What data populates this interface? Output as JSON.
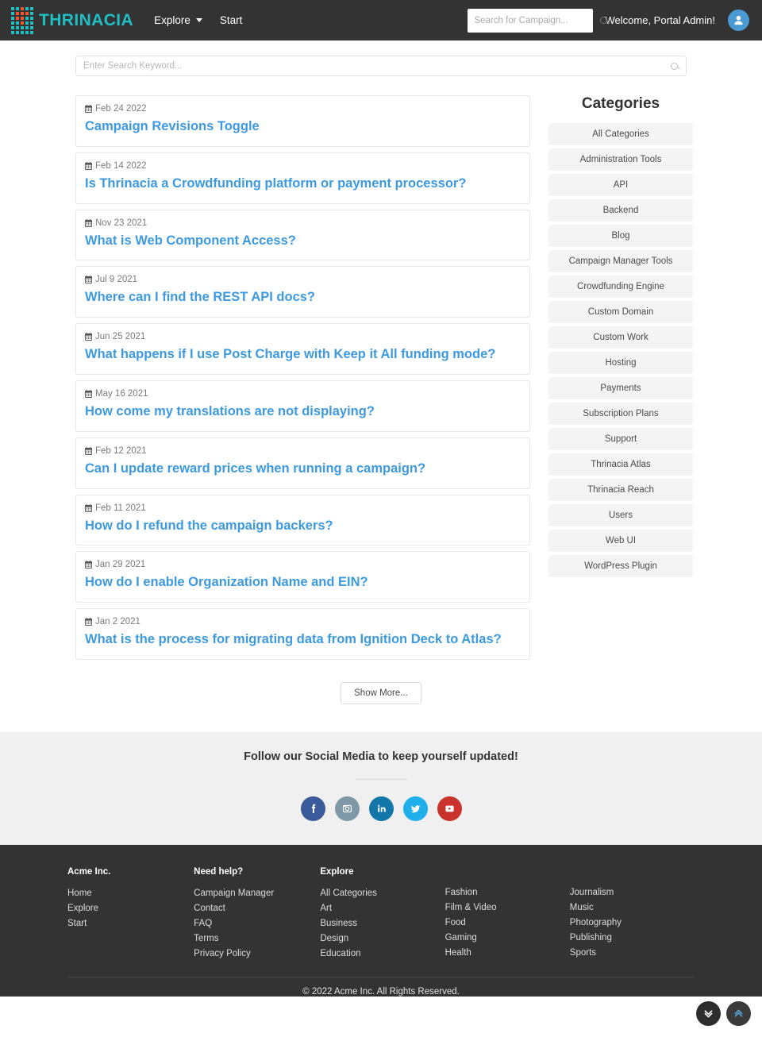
{
  "navbar": {
    "brand": "THRINACIA",
    "links": [
      {
        "label": "Explore",
        "has_caret": true,
        "icon": "chevron-down-icon"
      },
      {
        "label": "Start",
        "has_caret": false
      }
    ],
    "search": {
      "value": "",
      "placeholder": "Search for Campaign...",
      "icon": "search-icon"
    },
    "welcome": "Welcome, Portal Admin!",
    "avatar_icon": "user-avatar-icon",
    "bg_color": "#333333",
    "brand_color": "#1fbfc4",
    "brand_accent_color": "#f4572c"
  },
  "page_search": {
    "value": "",
    "placeholder": "Enter Search Keyword...",
    "icon": "search-icon"
  },
  "articles": {
    "items": [
      {
        "date": "Feb 24 2022",
        "title": "Campaign Revisions Toggle"
      },
      {
        "date": "Feb 14 2022",
        "title": "Is Thrinacia a Crowdfunding platform or payment processor?"
      },
      {
        "date": "Nov 23 2021",
        "title": "What is Web Component Access?"
      },
      {
        "date": "Jul 9 2021",
        "title": "Where can I find the REST API docs?"
      },
      {
        "date": "Jun 25 2021",
        "title": "What happens if I use Post Charge with Keep it All funding mode?"
      },
      {
        "date": "May 16 2021",
        "title": "How come my translations are not displaying?"
      },
      {
        "date": "Feb 12 2021",
        "title": "Can I update reward prices when running a campaign?"
      },
      {
        "date": "Feb 11 2021",
        "title": "How do I refund the campaign backers?"
      },
      {
        "date": "Jan 29 2021",
        "title": "How do I enable Organization Name and EIN?"
      },
      {
        "date": "Jan 2 2021",
        "title": "What is the process for migrating data from Ignition Deck to Atlas?"
      }
    ],
    "date_icon": "calendar-icon",
    "show_more_label": "Show More...",
    "title_color": "#3d9ae0"
  },
  "sidebar": {
    "title": "Categories",
    "items": [
      {
        "label": "All Categories"
      },
      {
        "label": "Administration Tools"
      },
      {
        "label": "API"
      },
      {
        "label": "Backend"
      },
      {
        "label": "Blog"
      },
      {
        "label": "Campaign Manager Tools"
      },
      {
        "label": "Crowdfunding Engine"
      },
      {
        "label": "Custom Domain"
      },
      {
        "label": "Custom Work"
      },
      {
        "label": "Hosting"
      },
      {
        "label": "Payments"
      },
      {
        "label": "Subscription Plans"
      },
      {
        "label": "Support"
      },
      {
        "label": "Thrinacia Atlas"
      },
      {
        "label": "Thrinacia Reach"
      },
      {
        "label": "Users"
      },
      {
        "label": "Web UI"
      },
      {
        "label": "WordPress Plugin"
      }
    ]
  },
  "social": {
    "title": "Follow our Social Media to keep yourself updated!",
    "icons": [
      {
        "name": "facebook-icon",
        "color": "#3b5a9a"
      },
      {
        "name": "instagram-icon",
        "color": "#7f98a8"
      },
      {
        "name": "linkedin-icon",
        "color": "#1277a8"
      },
      {
        "name": "twitter-icon",
        "color": "#1fb0ec"
      },
      {
        "name": "youtube-icon",
        "color": "#c9332b"
      }
    ]
  },
  "footer": {
    "columns": [
      {
        "title": "Acme Inc.",
        "links": [
          "Home",
          "Explore",
          "Start"
        ]
      },
      {
        "title": "Need help?",
        "links": [
          "Campaign Manager",
          "Contact",
          "FAQ",
          "Terms",
          "Privacy Policy"
        ]
      },
      {
        "title": "Explore",
        "links": [
          "All Categories",
          "Art",
          "Business",
          "Design",
          "Education"
        ]
      },
      {
        "title": "",
        "links": [
          "Fashion",
          "Film & Video",
          "Food",
          "Gaming",
          "Health"
        ]
      },
      {
        "title": "",
        "links": [
          "Journalism",
          "Music",
          "Photography",
          "Publishing",
          "Sports"
        ]
      }
    ],
    "copyright": "© 2022 Acme Inc. All Rights Reserved.",
    "bg_color": "#333333"
  },
  "floating_buttons": [
    {
      "name": "scroll-down-button",
      "icon": "double-chevron-down-icon",
      "color": "#ffffff"
    },
    {
      "name": "scroll-top-button",
      "icon": "double-chevron-up-icon",
      "color": "#5aa6d6"
    }
  ]
}
